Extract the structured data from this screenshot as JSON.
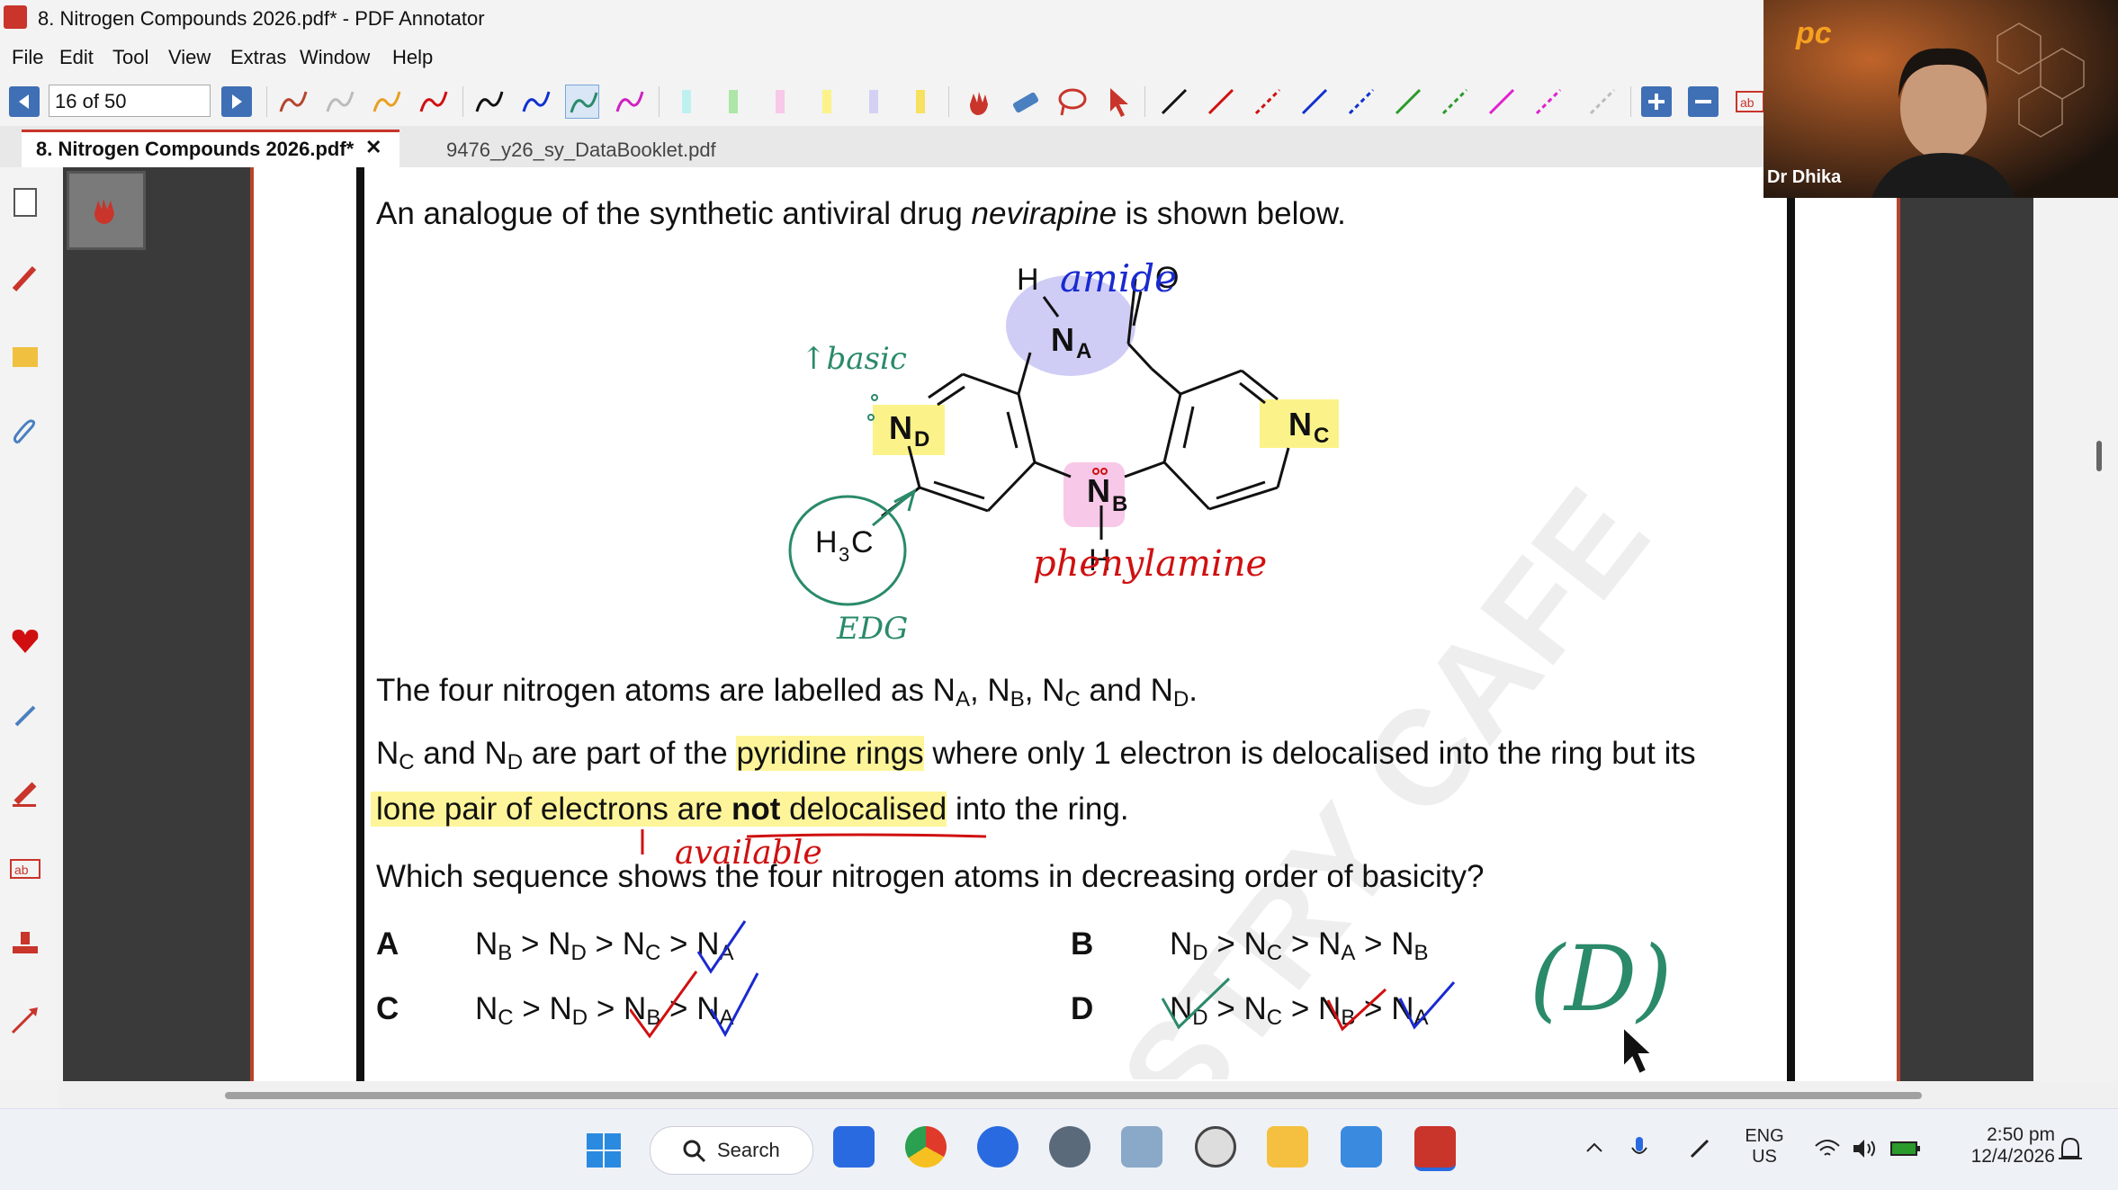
{
  "window": {
    "title": "8. Nitrogen Compounds 2026.pdf* - PDF Annotator"
  },
  "menu": [
    "File",
    "Edit",
    "Tool",
    "View",
    "Extras",
    "Window",
    "Help"
  ],
  "toolbar": {
    "page_indicator": "16 of 50"
  },
  "tabs": [
    {
      "label": "8. Nitrogen Compounds 2026.pdf*",
      "close": "✕"
    },
    {
      "label": "9476_y26_sy_DataBooklet.pdf"
    }
  ],
  "webcam": {
    "presenter": "Dr Dhika",
    "logo": "pc"
  },
  "document": {
    "intro_a": "An analogue of the synthetic antiviral drug ",
    "intro_b": "nevirapine",
    "intro_c": " is shown below.",
    "struct": {
      "H_top": "H",
      "O": "O",
      "NA": "N",
      "NA_sub": "A",
      "ND": "N",
      "ND_sub": "D",
      "NC": "N",
      "NC_sub": "C",
      "NB": "N",
      "NB_sub": "B",
      "H_bottom": "H",
      "methyl_H": "H",
      "methyl_3": "3",
      "methyl_C": "C"
    },
    "annotations": {
      "amide": "amide",
      "basic": "↑basic",
      "phenylamine": "phenylamine",
      "edg": "EDG",
      "available": "available",
      "answer": "(D)"
    },
    "labels_line": [
      "The four nitrogen atoms are labelled as N",
      "A",
      ", N",
      "B",
      ", N",
      "C",
      " and N",
      "D",
      "."
    ],
    "pyridine_line1": [
      "N",
      "C",
      " and N",
      "D",
      " are part of the ",
      "pyridine rings",
      " where only 1 electron is delocalised into the ring but its"
    ],
    "pyridine_line2": [
      "lone pair of electrons are ",
      "not",
      " delocalised",
      " into the ring."
    ],
    "question": "Which sequence shows the four nitrogen atoms in decreasing order of basicity?",
    "options": [
      {
        "letter": "A",
        "seq": [
          "N",
          "B",
          " > N",
          "D",
          " > N",
          "C",
          " > N",
          "A"
        ]
      },
      {
        "letter": "B",
        "seq": [
          "N",
          "D",
          " > N",
          "C",
          " > N",
          "A",
          " > N",
          "B"
        ]
      },
      {
        "letter": "C",
        "seq": [
          "N",
          "C",
          " > N",
          "D",
          " > N",
          "B",
          " > N",
          "A"
        ]
      },
      {
        "letter": "D",
        "seq": [
          "N",
          "D",
          " > N",
          "C",
          " > N",
          "B",
          " > N",
          "A"
        ]
      }
    ]
  },
  "taskbar": {
    "search": "Search",
    "lang": "ENG",
    "region": "US",
    "time": "2:50 pm",
    "date": "12/4/2026"
  }
}
